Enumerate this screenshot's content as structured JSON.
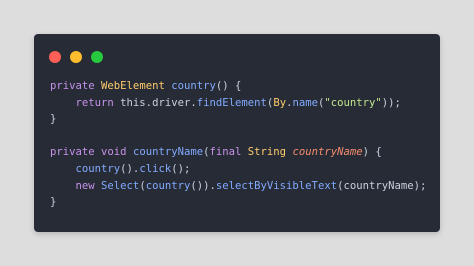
{
  "window_controls": [
    {
      "name": "close",
      "color": "#ff5f56"
    },
    {
      "name": "minimize",
      "color": "#ffbd2e"
    },
    {
      "name": "zoom",
      "color": "#27c93f"
    }
  ],
  "code_lines": [
    {
      "indent": "",
      "tokens": [
        {
          "text": "private",
          "color": "#c792ea"
        },
        {
          "text": " ",
          "color": "#c7d0de"
        },
        {
          "text": "WebElement",
          "color": "#ffcb6b"
        },
        {
          "text": " ",
          "color": "#c7d0de"
        },
        {
          "text": "country",
          "color": "#82aaff"
        },
        {
          "text": "() {",
          "color": "#c7d0de"
        }
      ]
    },
    {
      "indent": "    ",
      "tokens": [
        {
          "text": "return",
          "color": "#c792ea"
        },
        {
          "text": " this.",
          "color": "#c7d0de"
        },
        {
          "text": "driver",
          "color": "#c7d0de"
        },
        {
          "text": ".",
          "color": "#c7d0de"
        },
        {
          "text": "findElement",
          "color": "#82aaff"
        },
        {
          "text": "(",
          "color": "#c7d0de"
        },
        {
          "text": "By",
          "color": "#ffcb6b"
        },
        {
          "text": ".",
          "color": "#c7d0de"
        },
        {
          "text": "name",
          "color": "#82aaff"
        },
        {
          "text": "(",
          "color": "#c7d0de"
        },
        {
          "text": "\"country\"",
          "color": "#c3e88d"
        },
        {
          "text": "));",
          "color": "#c7d0de"
        }
      ]
    },
    {
      "indent": "",
      "tokens": [
        {
          "text": "}",
          "color": "#c7d0de"
        }
      ]
    },
    {
      "indent": "",
      "tokens": []
    },
    {
      "indent": "",
      "tokens": [
        {
          "text": "private",
          "color": "#c792ea"
        },
        {
          "text": " ",
          "color": "#c7d0de"
        },
        {
          "text": "void",
          "color": "#c792ea"
        },
        {
          "text": " ",
          "color": "#c7d0de"
        },
        {
          "text": "countryName",
          "color": "#82aaff"
        },
        {
          "text": "(",
          "color": "#c7d0de"
        },
        {
          "text": "final",
          "color": "#c792ea"
        },
        {
          "text": " ",
          "color": "#c7d0de"
        },
        {
          "text": "String",
          "color": "#ffcb6b"
        },
        {
          "text": " ",
          "color": "#c7d0de"
        },
        {
          "text": "countryName",
          "color": "#f78c6c",
          "italic": true
        },
        {
          "text": ") {",
          "color": "#c7d0de"
        }
      ]
    },
    {
      "indent": "    ",
      "tokens": [
        {
          "text": "country",
          "color": "#82aaff"
        },
        {
          "text": "().",
          "color": "#c7d0de"
        },
        {
          "text": "click",
          "color": "#82aaff"
        },
        {
          "text": "();",
          "color": "#c7d0de"
        }
      ]
    },
    {
      "indent": "    ",
      "tokens": [
        {
          "text": "new",
          "color": "#c792ea"
        },
        {
          "text": " ",
          "color": "#c7d0de"
        },
        {
          "text": "Select",
          "color": "#82aaff"
        },
        {
          "text": "(",
          "color": "#c7d0de"
        },
        {
          "text": "country",
          "color": "#82aaff"
        },
        {
          "text": "()).",
          "color": "#c7d0de"
        },
        {
          "text": "selectByVisibleText",
          "color": "#82aaff"
        },
        {
          "text": "(countryName);",
          "color": "#c7d0de"
        }
      ]
    },
    {
      "indent": "",
      "tokens": [
        {
          "text": "}",
          "color": "#c7d0de"
        }
      ]
    }
  ]
}
